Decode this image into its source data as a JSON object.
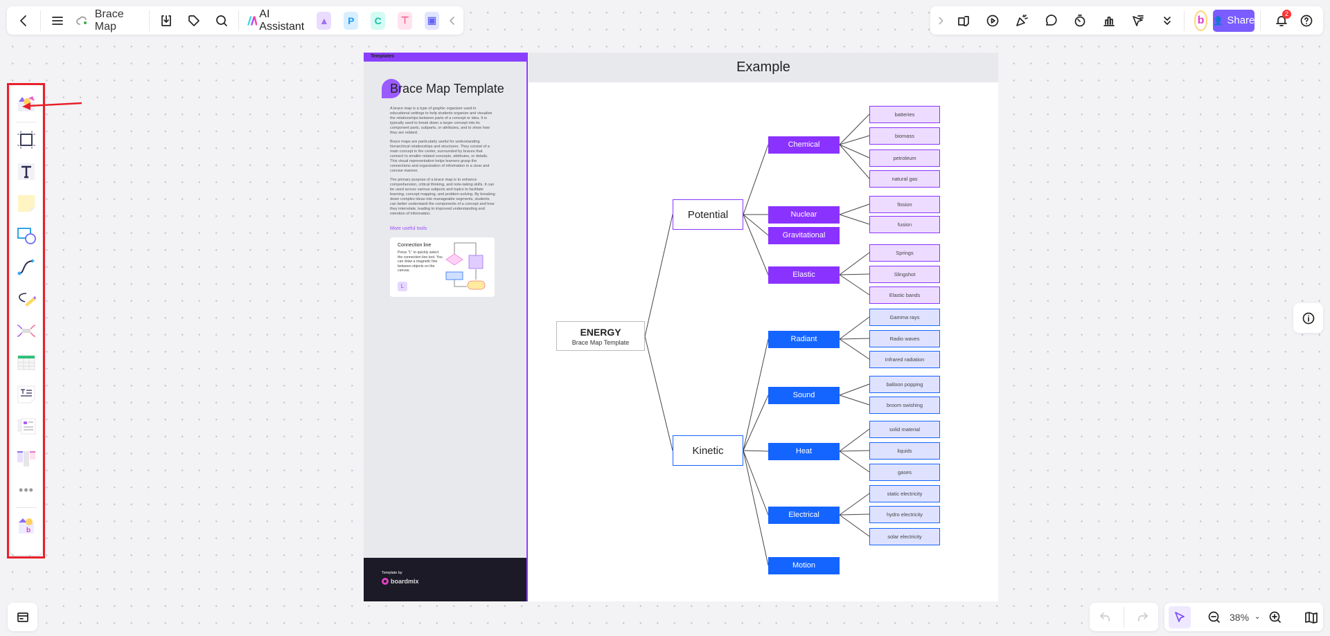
{
  "topbar": {
    "title": "Brace Map",
    "ai_label": "AI Assistant",
    "icons": [
      "back-icon",
      "menu-icon",
      "cloud-sync-icon",
      "download-icon",
      "tag-icon",
      "search-icon",
      "ai-assistant-icon",
      "ai-image-icon",
      "presentation-p-icon",
      "mindmap-icon",
      "flowchart-icon",
      "chat-icon",
      "collapse-left-icon"
    ]
  },
  "rightbar": {
    "share_label": "Share",
    "notification_count": "2",
    "icons": [
      "expand-right-icon",
      "sticky-lock-icon",
      "play-icon",
      "celebrate-icon",
      "comment-icon",
      "timer-icon",
      "vote-icon",
      "cursor-follow-icon",
      "more-down-icon",
      "avatar",
      "share-icon",
      "bell-icon",
      "help-icon"
    ]
  },
  "lefttools": [
    "template-library-icon",
    "frame-icon",
    "text-icon",
    "sticky-note-icon",
    "shape-icon",
    "connector-icon",
    "pen-icon",
    "mindmap-tool-icon",
    "table-icon",
    "document-icon",
    "card-icon",
    "kanban-icon",
    "more-icon",
    "plugins-icon"
  ],
  "template": {
    "header": "Templates",
    "title": "Brace Map Template",
    "paragraphs": [
      "A brace map is a type of graphic organizer used in educational settings to help students organize and visualize the relationships between parts of a concept or idea. It is typically used to break down a larger concept into its component parts, subparts, or attributes, and to show how they are related.",
      "Brace maps are particularly useful for understanding hierarchical relationships and structures. They consist of a main concept in the center, surrounded by braces that connect to smaller related concepts, attributes, or details. This visual representation helps learners grasp the connections and organization of information in a clear and concise manner.",
      "The primary purpose of a brace map is to enhance comprehension, critical thinking, and note-taking skills. It can be used across various subjects and topics to facilitate learning, concept mapping, and problem-solving. By breaking down complex ideas into manageable segments, students can better understand the components of a concept and how they interrelate, leading to improved understanding and retention of information."
    ],
    "tools_heading": "More useful tools",
    "card": {
      "title": "Connection line",
      "body": "Press \"L\" to quickly select the connection line tool. You can draw a magnetic line between objects on the canvas.",
      "key": "L"
    },
    "footer_by": "Template by",
    "footer_brand": "boardmix"
  },
  "example": {
    "header": "Example",
    "root": {
      "title": "ENERGY",
      "subtitle": "Brace Map Template"
    },
    "colors": {
      "potential": "#8a32ff",
      "potential_leaf": "#eddcff",
      "kinetic": "#1464ff",
      "kinetic_leaf": "#dfe2ff"
    },
    "groups": [
      {
        "label": "Potential",
        "children": [
          {
            "label": "Chemical",
            "leaves": [
              "batteries",
              "biomass",
              "petroleum",
              "natural gas"
            ]
          },
          {
            "label": "Nuclear",
            "leaves": [
              "fission",
              "fusion"
            ]
          },
          {
            "label": "Gravitational",
            "leaves": []
          },
          {
            "label": "Elastic",
            "leaves": [
              "Springs",
              "Slingshot",
              "Elastic bands"
            ]
          }
        ]
      },
      {
        "label": "Kinetic",
        "children": [
          {
            "label": "Radiant",
            "leaves": [
              "Gamma rays",
              "Radio waves",
              "Infrared radiation"
            ]
          },
          {
            "label": "Sound",
            "leaves": [
              "balloon popping",
              "broom swishing"
            ]
          },
          {
            "label": "Heat",
            "leaves": [
              "solid material",
              "liquids",
              "gases"
            ]
          },
          {
            "label": "Electrical",
            "leaves": [
              "static electricity",
              "hydro electricity",
              "solar electricity"
            ]
          },
          {
            "label": "Motion",
            "leaves": []
          }
        ]
      }
    ]
  },
  "bottom": {
    "zoom": "38%",
    "icons": [
      "undo-icon",
      "redo-icon",
      "select-cursor-icon",
      "zoom-out-icon",
      "zoom-in-icon",
      "map-icon",
      "minimap-toggle-icon",
      "info-icon"
    ]
  }
}
